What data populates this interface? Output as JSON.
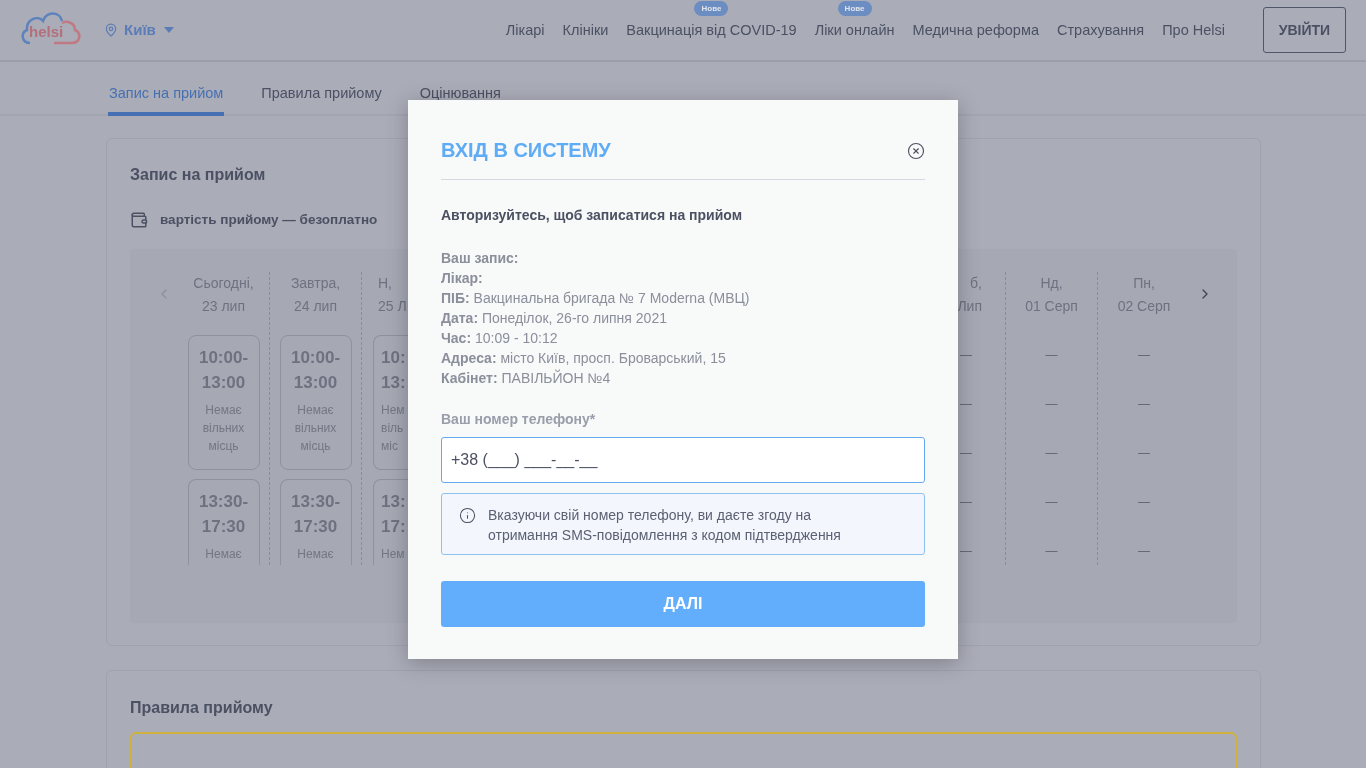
{
  "header": {
    "logo": "helsi",
    "city": "Київ",
    "nav": [
      {
        "label": "Лікарі"
      },
      {
        "label": "Клініки"
      },
      {
        "label": "Вакцинація від COVID-19",
        "badge": "Нове"
      },
      {
        "label": "Ліки онлайн",
        "badge": "Нове"
      },
      {
        "label": "Медична реформа"
      },
      {
        "label": "Страхування"
      },
      {
        "label": "Про Helsi"
      }
    ],
    "login_button": "УВІЙТИ"
  },
  "tabs": [
    {
      "label": "Запис на прийом",
      "selected": true
    },
    {
      "label": "Правила прийому",
      "selected": false
    },
    {
      "label": "Оцінювання",
      "selected": false
    }
  ],
  "booking": {
    "title": "Запис на прийом",
    "price": "вартість прийому — безоплатно",
    "columns": [
      {
        "kind": "full",
        "day": "Сьогодні,",
        "date": "23 лип",
        "slots": [
          {
            "time": "10:00-13:00",
            "status": "Немає вільних місць"
          },
          {
            "time": "13:30-17:30",
            "status": "Немає"
          }
        ]
      },
      {
        "kind": "full",
        "day": "Завтра,",
        "date": "24 лип",
        "slots": [
          {
            "time": "10:00-13:00",
            "status": "Немає вільних місць"
          },
          {
            "time": "13:30-17:30",
            "status": "Немає"
          }
        ]
      },
      {
        "kind": "cut_left",
        "day": "Н,",
        "date": "25 Л",
        "slots": [
          {
            "time": "10: 13:",
            "status": "Нем віль міс"
          },
          {
            "time": "13: 17:",
            "status": "Нем"
          }
        ]
      },
      {
        "kind": "cut_right",
        "day": "б,",
        "date": "Лип",
        "empty": [
          "—",
          "—",
          "—",
          "—",
          "—"
        ]
      },
      {
        "kind": "empty",
        "day": "Нд,",
        "date": "01 Серп",
        "empty": [
          "—",
          "—",
          "—",
          "—",
          "—"
        ]
      },
      {
        "kind": "empty",
        "day": "Пн,",
        "date": "02 Серп",
        "empty": [
          "—",
          "—",
          "—",
          "—",
          "—"
        ]
      }
    ]
  },
  "rules": {
    "title": "Правила прийому"
  },
  "modal": {
    "title": "ВХІД В СИСТЕМУ",
    "subtitle": "Авторизуйтесь, щоб записатися на прийом",
    "details": [
      "**Ваш запис:**",
      "**Лікар:**",
      "**ПІБ:** Вакцинальна бригада № 7 Moderna (МВЦ)",
      "**Дата:** Понеділок, 26-го липня 2021",
      "**Час:** 10:09 - 10:12",
      "**Адреса:** місто Київ, просп. Броварський, 15",
      "**Кабінет:** ПАВІЛЬЙОН №4"
    ],
    "phone_label": "Ваш номер телефону*",
    "phone_value": "+38 (___) ___-__-__",
    "notice": "Вказуючи свій номер телефону, ви даєте згоду на отримання SMS-повідомлення з кодом підтвердження",
    "submit": "ДАЛІ"
  }
}
